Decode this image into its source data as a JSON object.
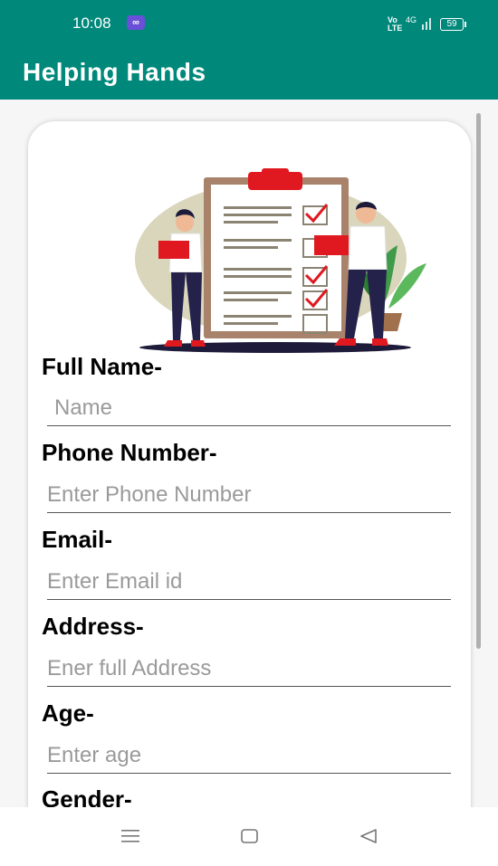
{
  "status_bar": {
    "time": "10:08",
    "link_glyph": "∞",
    "net_line1": "Vo",
    "net_line2": "LTE",
    "net_type": "4G",
    "battery": "59"
  },
  "app_bar": {
    "title": "Helping Hands"
  },
  "form": {
    "fields": [
      {
        "label": "Full Name-",
        "placeholder": "Name"
      },
      {
        "label": "Phone Number-",
        "placeholder": "Enter Phone Number"
      },
      {
        "label": "Email-",
        "placeholder": "Enter Email id"
      },
      {
        "label": "Address-",
        "placeholder": "Ener full Address"
      },
      {
        "label": "Age-",
        "placeholder": "Enter age"
      },
      {
        "label": "Gender-"
      }
    ]
  },
  "colors": {
    "primary": "#00897b",
    "accent_red": "#e0181f",
    "board_brown": "#a9826b"
  },
  "icons": [
    "menu-icon",
    "home-square-icon",
    "back-triangle-icon",
    "signal-icon",
    "battery-icon"
  ]
}
